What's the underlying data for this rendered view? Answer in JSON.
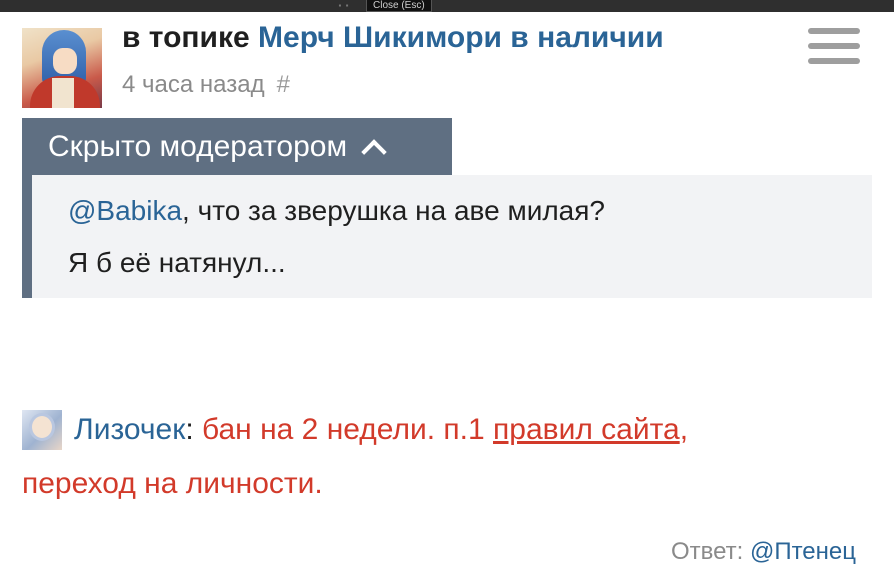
{
  "top_bar": {
    "close_label": "Close (Esc)"
  },
  "header": {
    "topic_prefix": "в топике",
    "topic_title": "Мерч Шикимори в наличии",
    "time_ago": "4 часа назад",
    "permalink": "#"
  },
  "moderation": {
    "hidden_label": "Скрыто модератором",
    "comment": {
      "mention": "@Babika",
      "line1_rest": ", что за зверушка на аве милая?",
      "line2": "Я б её натянул..."
    }
  },
  "mod_note": {
    "moderator_name": "Лизочек",
    "colon": ":",
    "text_before_link": " бан на 2 недели. п.1 ",
    "rules_link": "правил сайта",
    "after_link": ",",
    "line2": "переход на личности."
  },
  "reply": {
    "label": "Ответ:",
    "user": "@Птенец"
  },
  "colors": {
    "link": "#2a6496",
    "moderation_header": "#5f6f82",
    "moderation_body": "#f2f3f5",
    "ban_text": "#d23a2a",
    "muted": "#8a8a8a"
  },
  "icons": {
    "menu": "hamburger-menu-icon",
    "collapse": "chevron-up-icon"
  }
}
